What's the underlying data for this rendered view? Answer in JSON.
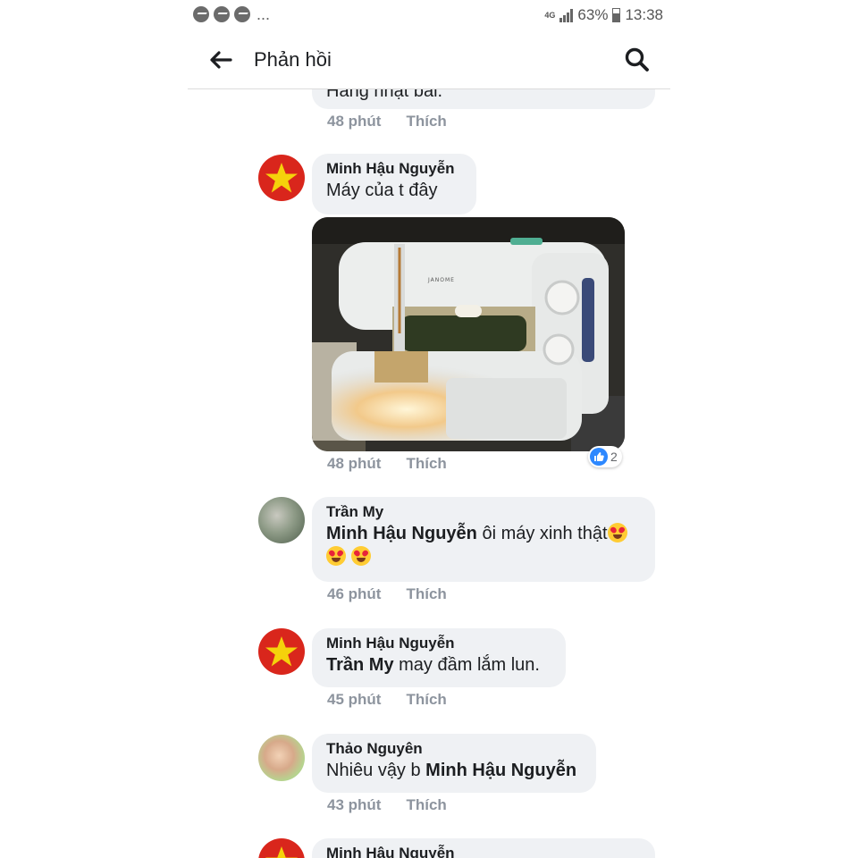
{
  "status_bar": {
    "notification_icons": [
      "messenger-icon",
      "messenger-icon",
      "messenger-icon"
    ],
    "more": "...",
    "network": "4G",
    "battery": "63%",
    "time": "13:38"
  },
  "header": {
    "title": "Phản hồi"
  },
  "comments": [
    {
      "author": "",
      "text": "Hàng nhật bãi.",
      "time": "48 phút",
      "like_label": "Thích"
    },
    {
      "author": "Minh Hậu Nguyễn",
      "text": "Máy của t đây",
      "time": "48 phút",
      "like_label": "Thích",
      "reaction_count": "2",
      "reaction_type": "like"
    },
    {
      "author": "Trần My",
      "mention": "Minh Hậu Nguyễn",
      "text": " ôi máy xinh thật",
      "time": "46 phút",
      "like_label": "Thích"
    },
    {
      "author": "Minh Hậu Nguyễn",
      "mention": "Trần My",
      "text": " may đầm lắm lun.",
      "time": "45 phút",
      "like_label": "Thích"
    },
    {
      "author": "Thảo Nguyên",
      "text": "Nhiêu vậy b ",
      "mention": "Minh Hậu Nguyễn",
      "time": "43 phút",
      "like_label": "Thích"
    },
    {
      "author": "Minh Hậu Nguyễn"
    }
  ],
  "colors": {
    "bubble": "#eff1f4",
    "meta": "#8d949e",
    "like_blue": "#2d88ff",
    "flag_red": "#d9261c"
  }
}
